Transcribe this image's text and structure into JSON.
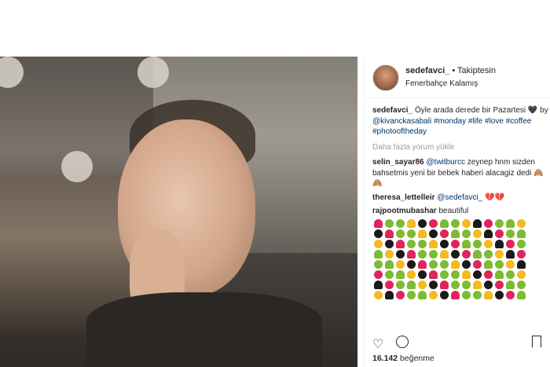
{
  "post": {
    "username": "sedefavci_",
    "follow_status": "• Takiptesin",
    "location": "Fenerbahçe Kalamış"
  },
  "caption": {
    "username": "sedefavci_",
    "text_part1": "Öyle arada derede bir Pazartesi",
    "heart": "🖤",
    "text_part2": "by",
    "mention": "@kivanckasabali",
    "hashtags": "#monday #life #love #coffee #photooftheday"
  },
  "load_more": "Daha fazla yorum yükle",
  "comments": [
    {
      "user": "selin_sayar86",
      "mention": "@twitburcc",
      "text": "zeynep hnm sizden bahsetmis yeni bir bebek haberi alacagiz dedi 🙈🙈"
    },
    {
      "user": "theresa_lettelleir",
      "mention": "@sedefavci_",
      "text": "💔💔"
    },
    {
      "user": "rajpootmubashar",
      "mention": "",
      "text": "beautiful"
    }
  ],
  "emoji_colors": [
    "#e0245e",
    "#e6b800",
    "#7cbb34",
    "#9b59b6",
    "#1a1a1a",
    "#f5b921",
    "#e0245e",
    "#7cbb34",
    "#9b59b6",
    "#f5b921",
    "#e6b800",
    "#e0245e"
  ],
  "likes": {
    "count": "16.142",
    "label": "beğenme"
  },
  "icons": {
    "like": "heart-icon",
    "comment": "comment-icon",
    "save": "bookmark-icon"
  }
}
